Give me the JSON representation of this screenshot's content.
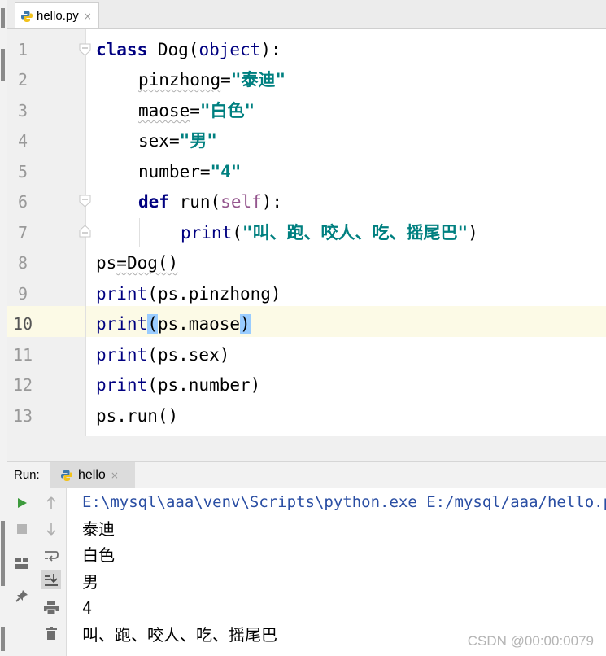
{
  "editor": {
    "tab": {
      "filename": "hello.py",
      "close": "×"
    },
    "line_numbers": [
      "1",
      "2",
      "3",
      "4",
      "5",
      "6",
      "7",
      "8",
      "9",
      "10",
      "11",
      "12",
      "13"
    ],
    "code": {
      "l1": {
        "kw": "class",
        "name": " Dog",
        "open": "(",
        "base": "object",
        "close": "):"
      },
      "l2": {
        "ident": "pinzhong",
        "eq": "=",
        "val": "\"泰迪\""
      },
      "l3": {
        "ident": "maose",
        "eq": "=",
        "val": "\"白色\""
      },
      "l4": {
        "ident": "sex",
        "eq": "=",
        "val": "\"男\""
      },
      "l5": {
        "ident": "number",
        "eq": "=",
        "val": "\"4\""
      },
      "l6": {
        "kw": "def",
        "name": " run",
        "open": "(",
        "param": "self",
        "close": "):"
      },
      "l7": {
        "fn": "print",
        "open": "(",
        "val": "\"叫、跑、咬人、吃、摇尾巴\"",
        "close": ")"
      },
      "l8": {
        "ident": "ps",
        "rest": "=Dog()"
      },
      "l9": {
        "fn": "print",
        "rest": "(ps.pinzhong)"
      },
      "l10": {
        "fn": "print",
        "open": "(",
        "mid": "ps.maose",
        "close": ")"
      },
      "l11": {
        "fn": "print",
        "rest": "(ps.sex)"
      },
      "l12": {
        "fn": "print",
        "rest": "(ps.number)"
      },
      "l13": {
        "text": "ps.run()"
      }
    }
  },
  "run_panel": {
    "label": "Run:",
    "tab_label": "hello",
    "tab_close": "×",
    "output": [
      "E:\\mysql\\aaa\\venv\\Scripts\\python.exe E:/mysql/aaa/hello.py",
      "泰迪",
      "白色",
      "男",
      "4",
      "叫、跑、咬人、吃、摇尾巴"
    ],
    "icons": [
      "run-icon",
      "stop-icon",
      "layout-icon",
      "pin-icon",
      "up-arrow-icon",
      "down-arrow-icon",
      "soft-wrap-icon",
      "scroll-to-end-icon",
      "print-icon",
      "trash-icon"
    ]
  },
  "watermark": "CSDN @00:00:0079",
  "colors": {
    "keyword": "#000080",
    "string": "#008080",
    "self": "#94558d",
    "current_line": "#fcfae6",
    "brace_highlight": "#99ccff",
    "console_command": "#2a4ea3",
    "run_green": "#3d9b3d"
  }
}
